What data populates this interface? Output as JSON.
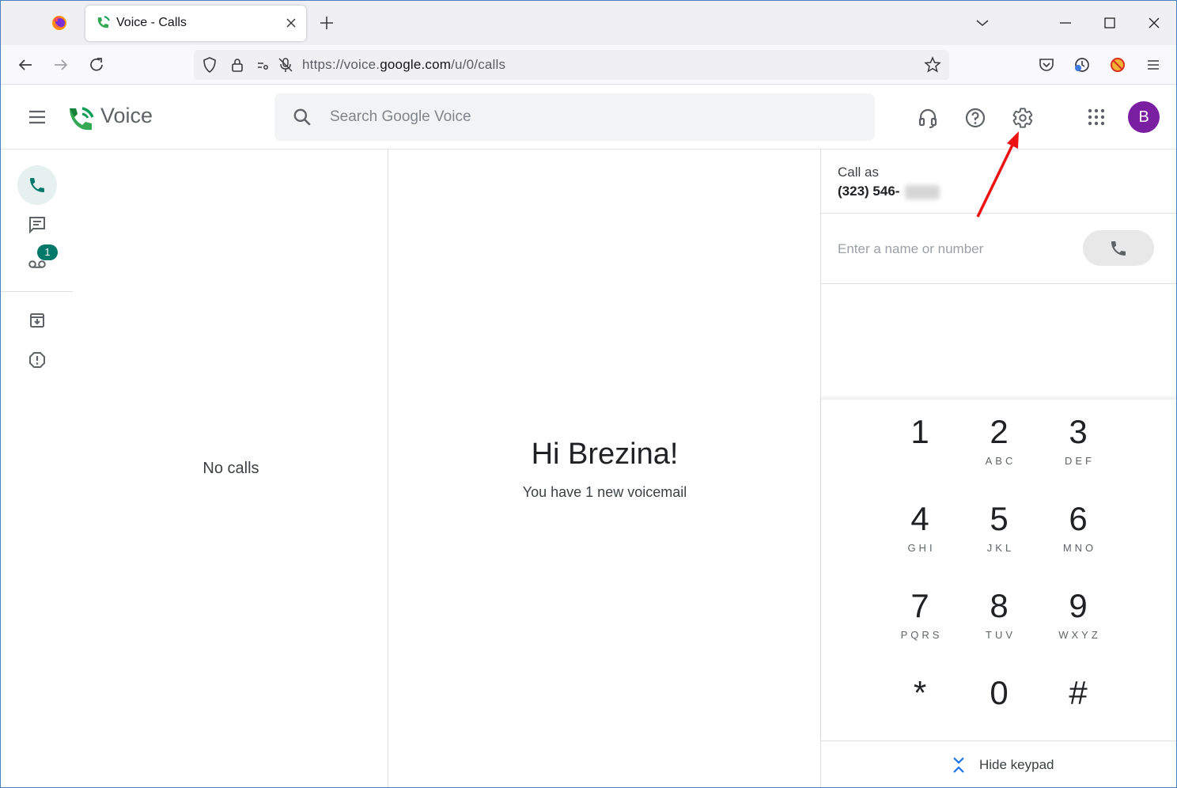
{
  "browser": {
    "tab_title": "Voice - Calls",
    "url_prefix": "https://voice.",
    "url_domain": "google.com",
    "url_path": "/u/0/calls"
  },
  "app": {
    "name": "Voice",
    "search_placeholder": "Search Google Voice",
    "avatar_initial": "B",
    "avatar_color": "#7b1fa2",
    "accent_color": "#00796b"
  },
  "rail": {
    "items": [
      {
        "name": "calls",
        "icon": "phone-icon",
        "active": true
      },
      {
        "name": "messages",
        "icon": "message-icon",
        "active": false
      },
      {
        "name": "voicemail",
        "icon": "voicemail-icon",
        "active": false,
        "badge": "1"
      },
      {
        "name": "archive",
        "icon": "archive-icon",
        "active": false
      },
      {
        "name": "spam",
        "icon": "spam-icon",
        "active": false
      }
    ]
  },
  "list": {
    "empty_text": "No calls"
  },
  "main": {
    "greeting": "Hi Brezina!",
    "voicemail_note": "You have 1 new voicemail"
  },
  "dialer": {
    "call_as_label": "Call as",
    "call_as_number": "(323) 546-",
    "input_placeholder": "Enter a name or number",
    "keys": [
      {
        "digit": "1",
        "letters": ""
      },
      {
        "digit": "2",
        "letters": "ABC"
      },
      {
        "digit": "3",
        "letters": "DEF"
      },
      {
        "digit": "4",
        "letters": "GHI"
      },
      {
        "digit": "5",
        "letters": "JKL"
      },
      {
        "digit": "6",
        "letters": "MNO"
      },
      {
        "digit": "7",
        "letters": "PQRS"
      },
      {
        "digit": "8",
        "letters": "TUV"
      },
      {
        "digit": "9",
        "letters": "WXYZ"
      },
      {
        "digit": "*",
        "letters": ""
      },
      {
        "digit": "0",
        "letters": ""
      },
      {
        "digit": "#",
        "letters": ""
      }
    ],
    "hide_keypad_label": "Hide keypad"
  }
}
